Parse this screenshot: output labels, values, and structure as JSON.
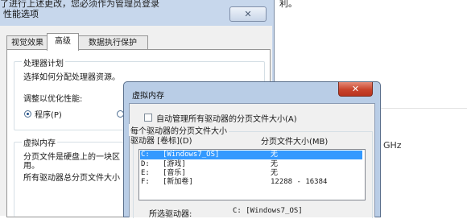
{
  "background": {
    "top_text": "了进行上述更改，您必须作为管理员登录",
    "right_text": "利。",
    "ghz_text": "GHz"
  },
  "performance_options": {
    "title": "性能选项",
    "close_symbol": "✕",
    "tabs": [
      {
        "label": "视觉效果",
        "active": false
      },
      {
        "label": "高级",
        "active": true
      },
      {
        "label": "数据执行保护",
        "active": false
      }
    ],
    "processor_scheduling": {
      "legend": "处理器计划",
      "description": "选择如何分配处理器资源。",
      "adjust_label": "调整以优化性能:",
      "option_programs": "程序(P)",
      "programs_checked": true
    },
    "virtual_memory": {
      "legend": "虚拟内存",
      "description_line1": "分页文件是硬盘上的一块区",
      "description_line2": "用。",
      "total_label": "所有驱动器总分页文件大小"
    }
  },
  "virtual_memory_dialog": {
    "title": "虚拟内存",
    "close_symbol": "✕",
    "auto_manage_label": "自动管理所有驱动器的分页文件大小(A)",
    "auto_manage_checked": false,
    "per_drive_legend": "每个驱动器的分页文件大小",
    "col_drive": "驱动器 [卷标](D)",
    "col_size": "分页文件大小(MB)",
    "drives": [
      {
        "drive": "C:",
        "label": "[Windows7_OS]",
        "size": "无",
        "selected": true
      },
      {
        "drive": "D:",
        "label": "[游戏]",
        "size": "无",
        "selected": false
      },
      {
        "drive": "E:",
        "label": "[音乐]",
        "size": "无",
        "selected": false
      },
      {
        "drive": "F:",
        "label": "[新加卷]",
        "size": "12288 - 16384",
        "selected": false
      }
    ],
    "selected_drive_label": "所选驱动器:",
    "selected_drive_value": "C:  [Windows7_OS]"
  }
}
